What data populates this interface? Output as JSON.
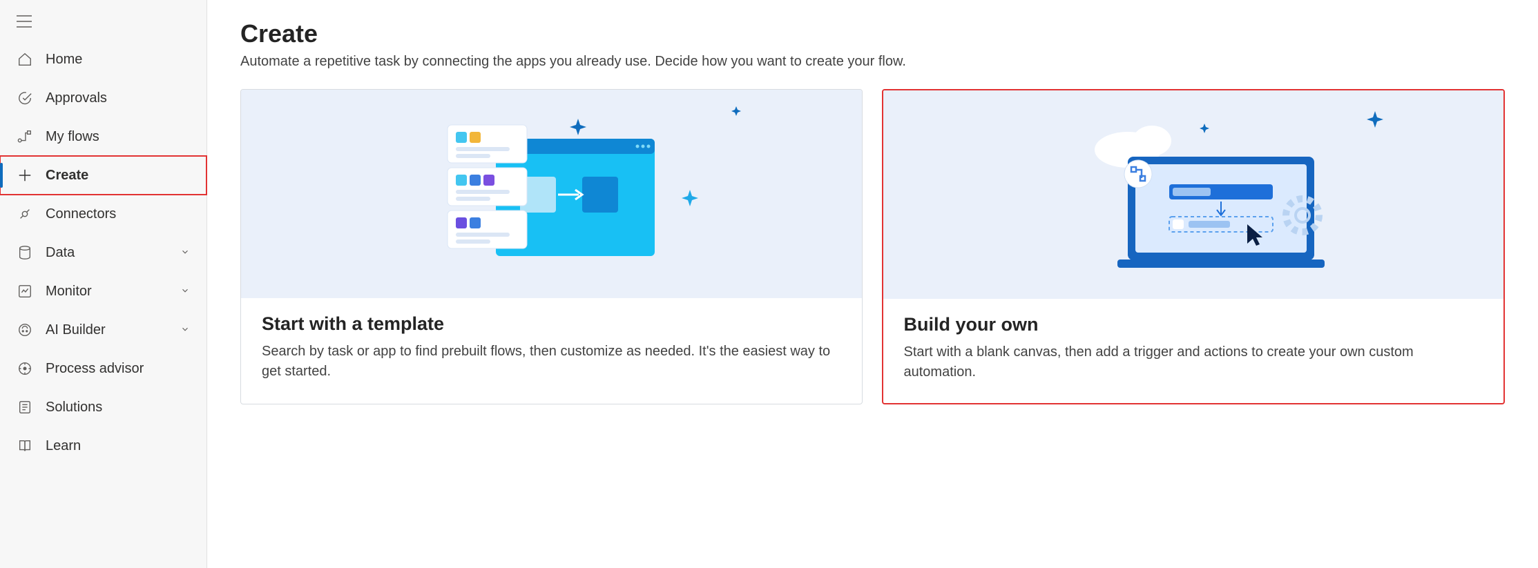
{
  "sidebar": {
    "items": [
      {
        "label": "Home"
      },
      {
        "label": "Approvals"
      },
      {
        "label": "My flows"
      },
      {
        "label": "Create"
      },
      {
        "label": "Connectors"
      },
      {
        "label": "Data"
      },
      {
        "label": "Monitor"
      },
      {
        "label": "AI Builder"
      },
      {
        "label": "Process advisor"
      },
      {
        "label": "Solutions"
      },
      {
        "label": "Learn"
      }
    ]
  },
  "main": {
    "title": "Create",
    "subtitle": "Automate a repetitive task by connecting the apps you already use. Decide how you want to create your flow."
  },
  "cards": {
    "template": {
      "title": "Start with a template",
      "desc": "Search by task or app to find prebuilt flows, then customize as needed. It's the easiest way to get started."
    },
    "build": {
      "title": "Build your own",
      "desc": "Start with a blank canvas, then add a trigger and actions to create your own custom automation."
    }
  }
}
